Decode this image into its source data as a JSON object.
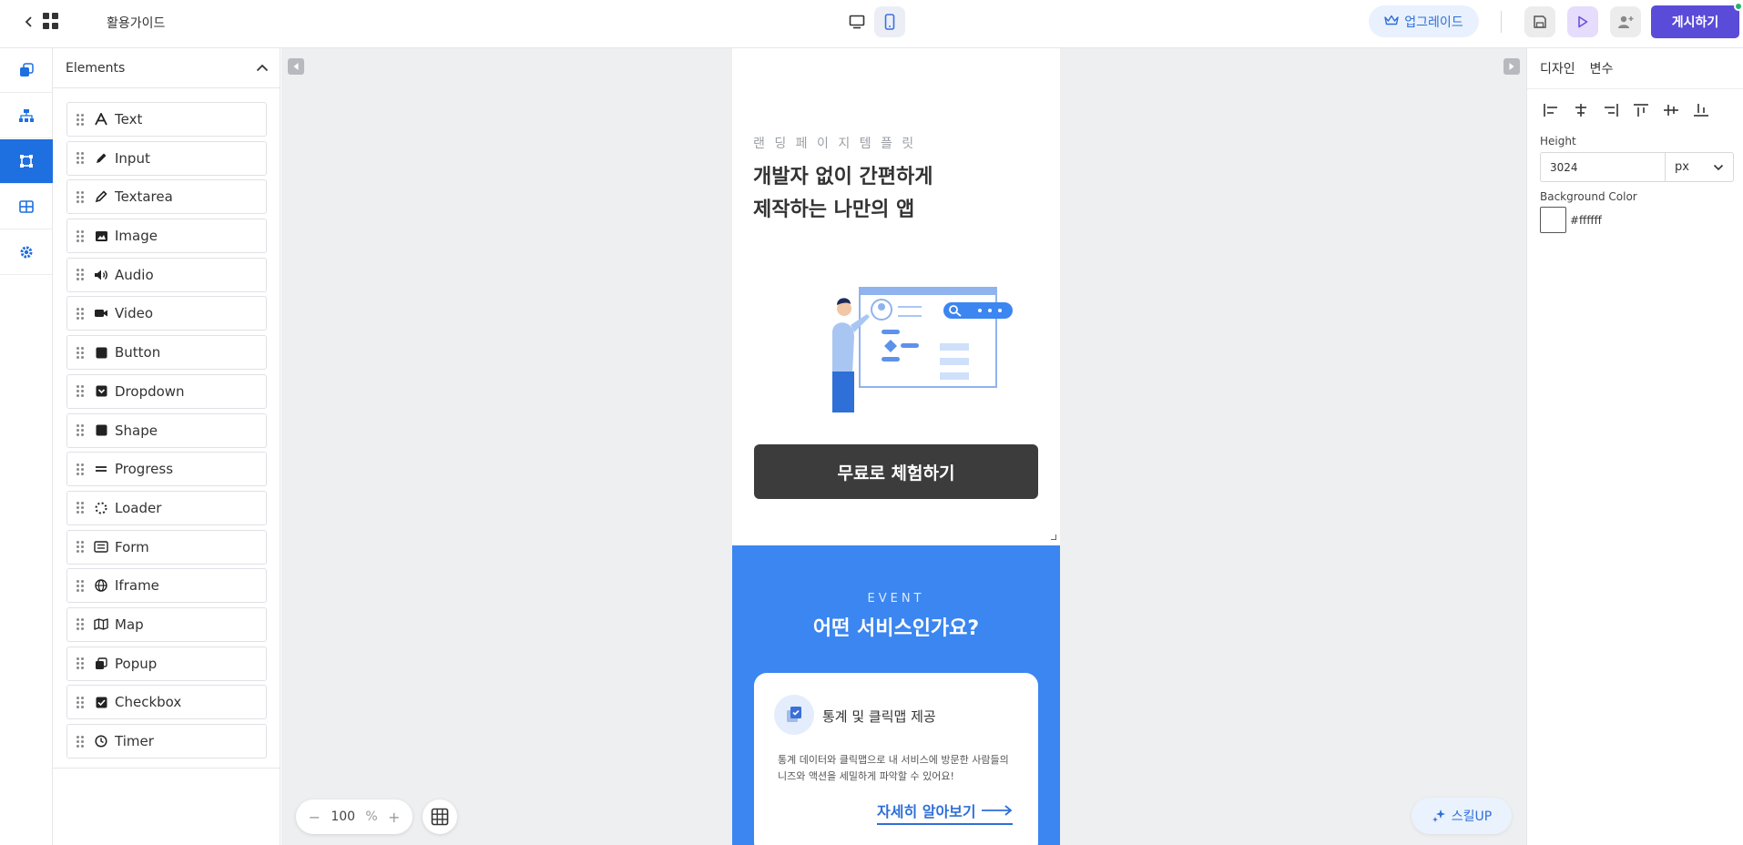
{
  "topbar": {
    "title": "활용가이드",
    "upgrade_label": "업그레이드",
    "publish_label": "게시하기"
  },
  "elements_panel": {
    "title": "Elements",
    "items": [
      {
        "label": "Text",
        "icon": "text-icon"
      },
      {
        "label": "Input",
        "icon": "pencil-icon"
      },
      {
        "label": "Textarea",
        "icon": "pen-icon"
      },
      {
        "label": "Image",
        "icon": "image-icon"
      },
      {
        "label": "Audio",
        "icon": "speaker-icon"
      },
      {
        "label": "Video",
        "icon": "video-camera-icon"
      },
      {
        "label": "Button",
        "icon": "square-icon"
      },
      {
        "label": "Dropdown",
        "icon": "dropdown-icon"
      },
      {
        "label": "Shape",
        "icon": "square-icon"
      },
      {
        "label": "Progress",
        "icon": "equals-icon"
      },
      {
        "label": "Loader",
        "icon": "spinner-icon"
      },
      {
        "label": "Form",
        "icon": "form-icon"
      },
      {
        "label": "Iframe",
        "icon": "globe-icon"
      },
      {
        "label": "Map",
        "icon": "map-icon"
      },
      {
        "label": "Popup",
        "icon": "popup-icon"
      },
      {
        "label": "Checkbox",
        "icon": "checkbox-icon"
      },
      {
        "label": "Timer",
        "icon": "clock-icon"
      }
    ]
  },
  "phone": {
    "eyebrow": "랜 딩 페 이 지 템 플 릿",
    "title_line1": "개발자 없이 간편하게",
    "title_line2": "제작하는 나만의 앱",
    "cta": "무료로 체험하기",
    "event_label": "EVENT",
    "event_title": "어떤 서비스인가요?",
    "card": {
      "title": "통계 및 클릭맵 제공",
      "desc_line1": "통계 데이터와 클릭맵으로 내 서비스에 방문한 사람들의",
      "desc_line2": "니즈와 액션을 세밀하게 파악할 수 있어요!",
      "link": "자세히 알아보기"
    }
  },
  "zoom": {
    "value": "100",
    "unit": "%",
    "minus": "−",
    "plus": "+"
  },
  "skill_button": "스킬UP",
  "right_panel": {
    "tab_design": "디자인",
    "tab_vars": "변수",
    "height_label": "Height",
    "height_value": "3024",
    "height_unit": "px",
    "bg_label": "Background Color",
    "bg_value": "#ffffff"
  },
  "colors": {
    "accent": "#1e6fe0",
    "publish": "#5a4bd8",
    "event_bg": "#3b86f0",
    "cta_bg": "#3c3c3c"
  }
}
